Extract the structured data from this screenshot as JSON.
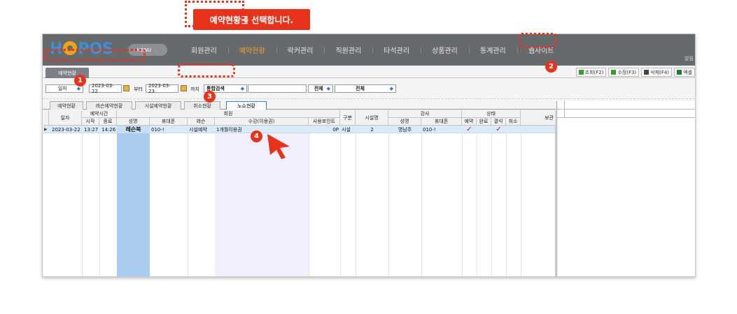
{
  "callout": "예약현황를 선택합니다.",
  "app": {
    "logo_letters": [
      "H",
      "POS"
    ],
    "menu_button": "MENU",
    "nav": [
      "회원관리",
      "예약현황",
      "락커관리",
      "직원관리",
      "타석관리",
      "상품관리",
      "통계관리",
      "웹사이트"
    ],
    "active_nav": "예약현황",
    "topright_text": "알림"
  },
  "subbar": {
    "main_tab": "예약현황",
    "tools": [
      {
        "label": "조회(F2)",
        "icon": "search-icon",
        "color": "#3a9a3a"
      },
      {
        "label": "수정(F3)",
        "icon": "edit-icon",
        "color": "#3a9a3a"
      },
      {
        "label": "삭제(F4)",
        "icon": "trash-icon",
        "color": "#444444"
      },
      {
        "label": "엑셀",
        "icon": "excel-icon",
        "color": "#1e7a3a"
      }
    ]
  },
  "filter": {
    "date_type": "일자",
    "date_from": "2023-03-22",
    "from_label": "부터",
    "date_to": "2023-03-23",
    "to_label": "까지",
    "search_type": "통합검색",
    "search_value": "",
    "select1": "전체",
    "select2": "전체"
  },
  "tabs": [
    "예약현황",
    "레슨예약현황",
    "시설예약현황",
    "취소현황",
    "노쇼현황"
  ],
  "selected_tab": "노쇼현황",
  "grid": {
    "headers": {
      "date": "일자",
      "time_group": "예약시간",
      "start": "시작",
      "end": "종료",
      "member_group": "회원",
      "name": "성명",
      "phone": "휴대폰",
      "lesson": "레슨",
      "ticket": "수강(이용권)",
      "points": "사용포인트",
      "category": "구분",
      "facility": "시설명",
      "instructor_group": "강사",
      "inst_name": "성명",
      "inst_phone": "휴대폰",
      "status_group": "상태",
      "reserved": "예약",
      "done": "완료",
      "absent": "결석",
      "cancel": "취소",
      "note": "보관"
    },
    "rows": [
      {
        "date": "2023-03-22",
        "start": "13:27",
        "end": "14:26",
        "name": "레슨북",
        "phone": "010-!",
        "lesson": "시설예약",
        "ticket": "1개월이용권",
        "points": "0P",
        "category": "시설",
        "facility": "2",
        "inst_name": "명남주",
        "inst_phone": "010-!",
        "reserved": "✓",
        "done": "",
        "absent": "✓",
        "cancel": "",
        "note": ""
      }
    ]
  },
  "badges": [
    "1",
    "2",
    "3",
    "4"
  ],
  "colors": {
    "accent": "#e8331c",
    "topbar": "#676a6d",
    "active_nav": "#f3a12a",
    "selected_row": "#dbeaf7",
    "name_column": "#a9cbef"
  }
}
